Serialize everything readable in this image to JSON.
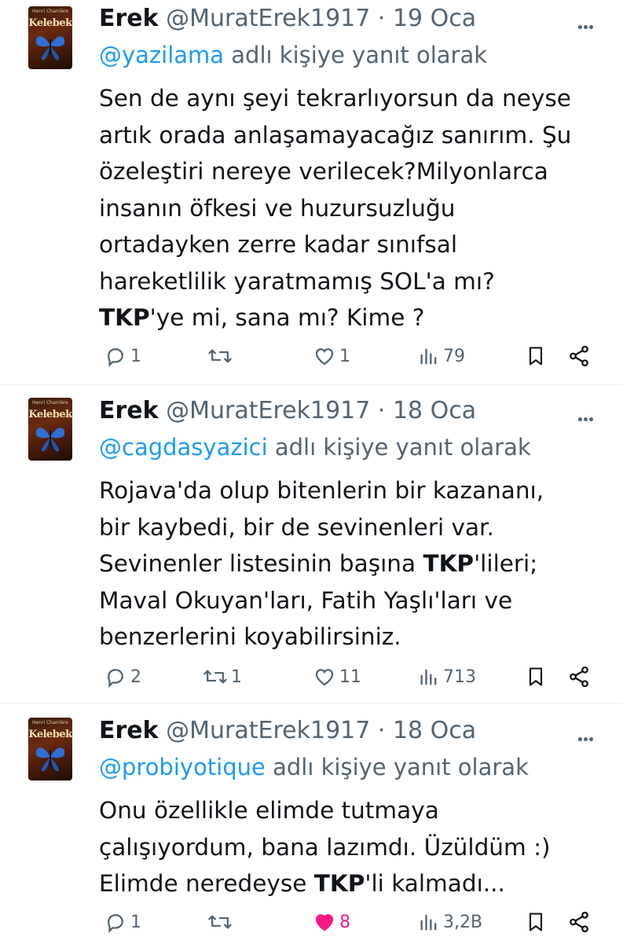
{
  "tweets": [
    {
      "name": "Erek",
      "handle": "@MuratErek1917",
      "dot": "·",
      "date": "19 Oca",
      "reply_handle": "@yazilama",
      "reply_suffix": " adlı kişiye yanıt olarak",
      "body_lines": [
        [
          "Sen de aynı şeyi tekrarlıyorsun da neyse"
        ],
        [
          "artık orada anlaşamayacağız sanırım. Şu"
        ],
        [
          "özeleştiri nereye verilecek?Milyonlarca"
        ],
        [
          "insanın öfkesi ve huzursuzluğu"
        ],
        [
          "ortadayken zerre kadar sınıfsal"
        ],
        [
          "hareketlilik yaratmamış SOL'a mı?"
        ],
        [
          "TKP",
          "'ye mi, sana mı? Kime ?"
        ]
      ],
      "replies": "1",
      "retweets": "",
      "likes": "1",
      "views": "79",
      "liked": false
    },
    {
      "name": "Erek",
      "handle": "@MuratErek1917",
      "dot": "·",
      "date": "18 Oca",
      "reply_handle": "@cagdasyazici",
      "reply_suffix": " adlı kişiye yanıt olarak",
      "body_lines": [
        [
          "Rojava'da olup bitenlerin bir kazananı,"
        ],
        [
          "bir kaybedi, bir de sevinenleri var."
        ],
        [
          "Sevinenler listesinin başına ",
          "TKP",
          "'lileri;"
        ],
        [
          "Maval Okuyan'ları, Fatih Yaşlı'ları ve"
        ],
        [
          "benzerlerini koyabilirsiniz."
        ]
      ],
      "replies": "2",
      "retweets": "1",
      "likes": "11",
      "views": "713",
      "liked": false
    },
    {
      "name": "Erek",
      "handle": "@MuratErek1917",
      "dot": "·",
      "date": "18 Oca",
      "reply_handle": "@probiyotique",
      "reply_suffix": " adlı kişiye yanıt olarak",
      "body_lines": [
        [
          "Onu özellikle elimde tutmaya"
        ],
        [
          "çalışıyordum, bana lazımdı. Üzüldüm :)"
        ],
        [
          "Elimde neredeyse ",
          "TKP",
          "'li kalmadı..."
        ]
      ],
      "replies": "1",
      "retweets": "",
      "likes": "8",
      "views": "3,2B",
      "liked": true
    }
  ],
  "avatar": {
    "title": "Kelebek",
    "subtitle": "Henri Charrière"
  },
  "colors": {
    "link": "#1d9bf0",
    "muted": "#536471",
    "text": "#0f1419",
    "like": "#f91880",
    "divider": "#e6ecf0"
  },
  "icons": [
    "avatar-image",
    "more-icon",
    "reply-icon",
    "retweet-icon",
    "like-icon",
    "views-icon",
    "bookmark-icon",
    "share-icon"
  ]
}
